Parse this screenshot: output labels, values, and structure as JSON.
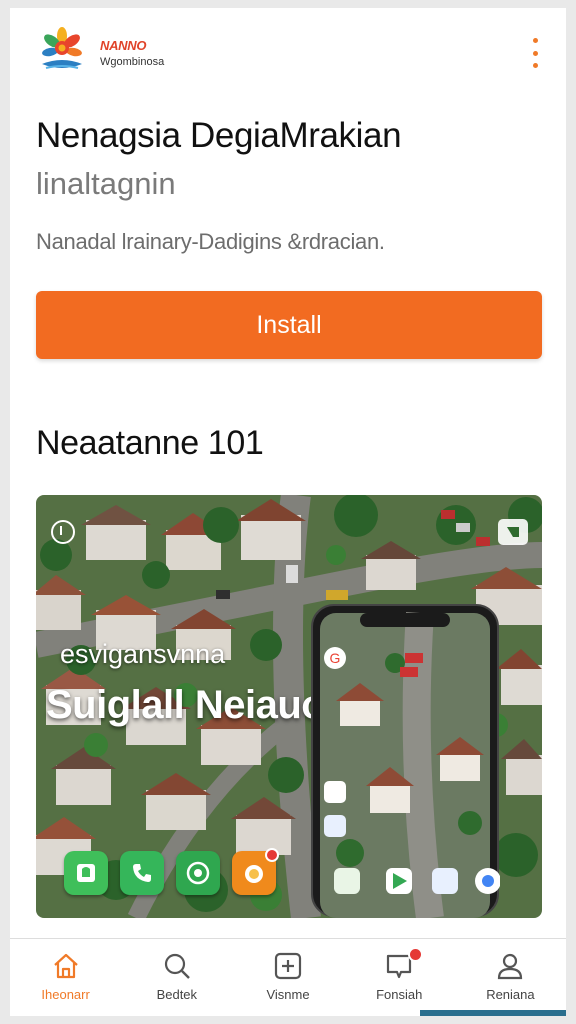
{
  "header": {
    "brand_name": "NANNO",
    "brand_sub": "Wgombinosa",
    "logo_icon": "sunflower-logo-icon",
    "menu_icon": "kebab-menu-icon"
  },
  "app": {
    "title": "Nenagsia DegiaMrakian",
    "subtitle": "linaltagnin",
    "description": "Nanadal lrainary-Dadigins  &rdracian.",
    "install_label": "Install"
  },
  "section": {
    "title": "Neaatanne 101"
  },
  "hero": {
    "tagline": "esvigansvnna",
    "title": "Suiglall Neiauon",
    "apps": [
      {
        "icon": "contacts-app-icon",
        "color": "#3fbf5a"
      },
      {
        "icon": "phone-app-icon",
        "color": "#35b65a"
      },
      {
        "icon": "whatsapp-app-icon",
        "color": "#2fa74f"
      },
      {
        "icon": "camera-app-icon",
        "color": "#f08a1c"
      }
    ],
    "phone_apps": [
      "google-icon",
      "maps-icon",
      "settings-icon",
      "files-icon",
      "play-store-icon",
      "messages-icon",
      "chrome-icon"
    ]
  },
  "nav": {
    "items": [
      {
        "label": "Iheonarr",
        "icon": "home-icon"
      },
      {
        "label": "Bedtek",
        "icon": "search-icon"
      },
      {
        "label": "Visnme",
        "icon": "add-icon"
      },
      {
        "label": "Fonsiah",
        "icon": "chat-icon"
      },
      {
        "label": "Reniana",
        "icon": "profile-icon"
      }
    ]
  },
  "colors": {
    "accent": "#f26b21",
    "nav_active": "#f07a28",
    "badge": "#e53935"
  }
}
